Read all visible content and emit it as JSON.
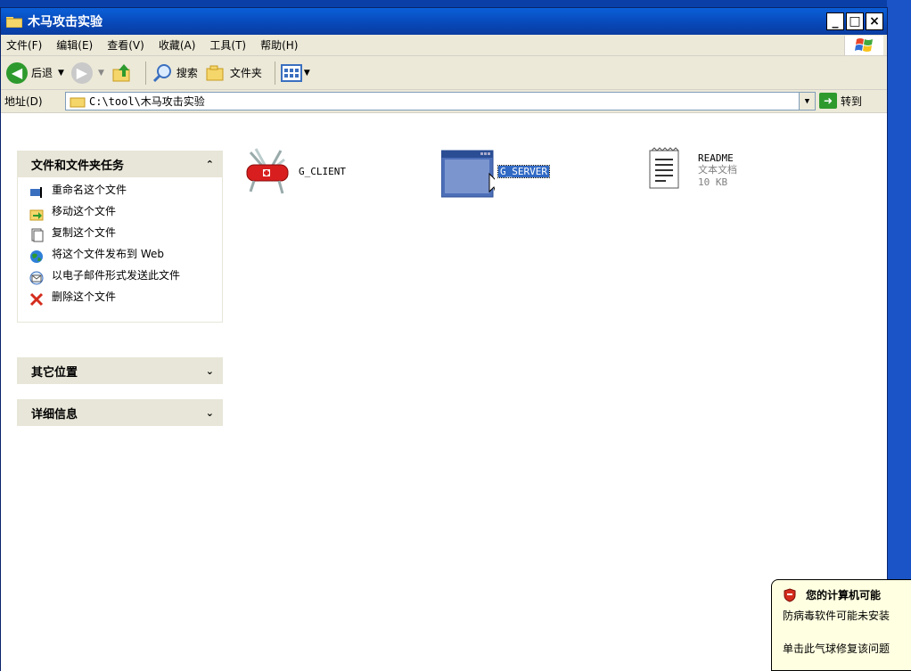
{
  "window": {
    "title": "木马攻击实验",
    "minimize": "_",
    "maximize": "□",
    "close": "×"
  },
  "menubar": {
    "items": [
      "文件(F)",
      "编辑(E)",
      "查看(V)",
      "收藏(A)",
      "工具(T)",
      "帮助(H)"
    ]
  },
  "toolbar": {
    "back_label": "后退",
    "search_label": "搜索",
    "folders_label": "文件夹"
  },
  "address": {
    "label": "地址(D)",
    "path": "C:\\tool\\木马攻击实验",
    "go_label": "转到"
  },
  "tasks_panel": {
    "title": "文件和文件夹任务",
    "items": [
      {
        "label": "重命名这个文件",
        "icon": "rename-icon"
      },
      {
        "label": "移动这个文件",
        "icon": "move-icon"
      },
      {
        "label": "复制这个文件",
        "icon": "copy-icon"
      },
      {
        "label": "将这个文件发布到 Web",
        "icon": "web-publish-icon"
      },
      {
        "label": "以电子邮件形式发送此文件",
        "icon": "email-icon"
      },
      {
        "label": "删除这个文件",
        "icon": "delete-icon"
      }
    ]
  },
  "other_places": {
    "title": "其它位置"
  },
  "details": {
    "title": "详细信息"
  },
  "files": [
    {
      "name": "G_CLIENT",
      "icon": "swiss-knife-icon"
    },
    {
      "name": "G_SERVER",
      "icon": "application-window-icon",
      "selected": true
    },
    {
      "name": "README",
      "type": "文本文档",
      "size": "10 KB",
      "icon": "text-document-icon"
    }
  ],
  "balloon": {
    "title": "您的计算机可能",
    "line1": "防病毒软件可能未安装",
    "line2": "单击此气球修复该问题"
  },
  "colors": {
    "titlebar": "#0847b7",
    "selection": "#316ac5",
    "panel_head": "#e8e6d8",
    "desktop": "#0a3fa8"
  }
}
